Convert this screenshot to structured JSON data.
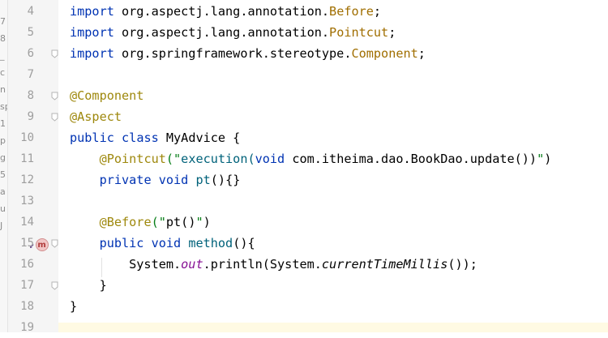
{
  "editor": {
    "line_numbers": [
      "4",
      "5",
      "6",
      "7",
      "8",
      "9",
      "10",
      "11",
      "12",
      "13",
      "14",
      "15",
      "16",
      "17",
      "18",
      "19"
    ],
    "left_strip_fragments": [
      "7",
      "8",
      "_",
      "c",
      "n",
      "sp",
      "1",
      "p",
      "g",
      "5",
      "a",
      "u",
      "J"
    ],
    "lines": [
      [
        {
          "t": "import",
          "c": "kw"
        },
        {
          "t": " org.aspectj.lang.annotation.",
          "c": "pkg"
        },
        {
          "t": "Before",
          "c": "cls"
        },
        {
          "t": ";",
          "c": "plain"
        }
      ],
      [
        {
          "t": "import",
          "c": "kw"
        },
        {
          "t": " org.aspectj.lang.annotation.",
          "c": "pkg"
        },
        {
          "t": "Pointcut",
          "c": "cls"
        },
        {
          "t": ";",
          "c": "plain"
        }
      ],
      [
        {
          "t": "import",
          "c": "kw"
        },
        {
          "t": " org.springframework.stereotype.",
          "c": "pkg"
        },
        {
          "t": "Component",
          "c": "cls"
        },
        {
          "t": ";",
          "c": "plain"
        }
      ],
      [],
      [
        {
          "t": "@Component",
          "c": "ann"
        }
      ],
      [
        {
          "t": "@Aspect",
          "c": "ann"
        }
      ],
      [
        {
          "t": "public",
          "c": "kw"
        },
        {
          "t": " ",
          "c": "plain"
        },
        {
          "t": "class",
          "c": "kw"
        },
        {
          "t": " MyAdvice {",
          "c": "plain"
        }
      ],
      [
        {
          "t": "    ",
          "c": "plain"
        },
        {
          "t": "@Pointcut",
          "c": "ann"
        },
        {
          "t": "(\"",
          "c": "str"
        },
        {
          "t": "execution(",
          "c": "method"
        },
        {
          "t": "void",
          "c": "kw"
        },
        {
          "t": " com.itheima.dao.BookDao.update())",
          "c": "plain"
        },
        {
          "t": "\"",
          "c": "str"
        },
        {
          "t": ")",
          "c": "plain"
        }
      ],
      [
        {
          "t": "    ",
          "c": "plain"
        },
        {
          "t": "private",
          "c": "kw"
        },
        {
          "t": " ",
          "c": "plain"
        },
        {
          "t": "void",
          "c": "kw"
        },
        {
          "t": " ",
          "c": "plain"
        },
        {
          "t": "pt",
          "c": "method"
        },
        {
          "t": "(){}",
          "c": "plain"
        }
      ],
      [],
      [
        {
          "t": "    ",
          "c": "plain"
        },
        {
          "t": "@Before",
          "c": "ann"
        },
        {
          "t": "(\"",
          "c": "str"
        },
        {
          "t": "pt()",
          "c": "plain"
        },
        {
          "t": "\"",
          "c": "str"
        },
        {
          "t": ")",
          "c": "plain"
        }
      ],
      [
        {
          "t": "    ",
          "c": "plain"
        },
        {
          "t": "public",
          "c": "kw"
        },
        {
          "t": " ",
          "c": "plain"
        },
        {
          "t": "void",
          "c": "kw"
        },
        {
          "t": " ",
          "c": "plain"
        },
        {
          "t": "method",
          "c": "method"
        },
        {
          "t": "(){",
          "c": "plain"
        }
      ],
      [
        {
          "t": "        System.",
          "c": "plain"
        },
        {
          "t": "out",
          "c": "field"
        },
        {
          "t": ".println(System.",
          "c": "plain"
        },
        {
          "t": "currentTimeMillis",
          "c": "static-call"
        },
        {
          "t": "());",
          "c": "plain"
        }
      ],
      [
        {
          "t": "    }",
          "c": "plain"
        }
      ],
      [
        {
          "t": "}",
          "c": "plain"
        }
      ],
      []
    ],
    "fold_markers_on_lines": [
      6,
      8,
      9,
      15,
      17
    ],
    "override_marker": {
      "line": "15",
      "icon": "m"
    }
  }
}
